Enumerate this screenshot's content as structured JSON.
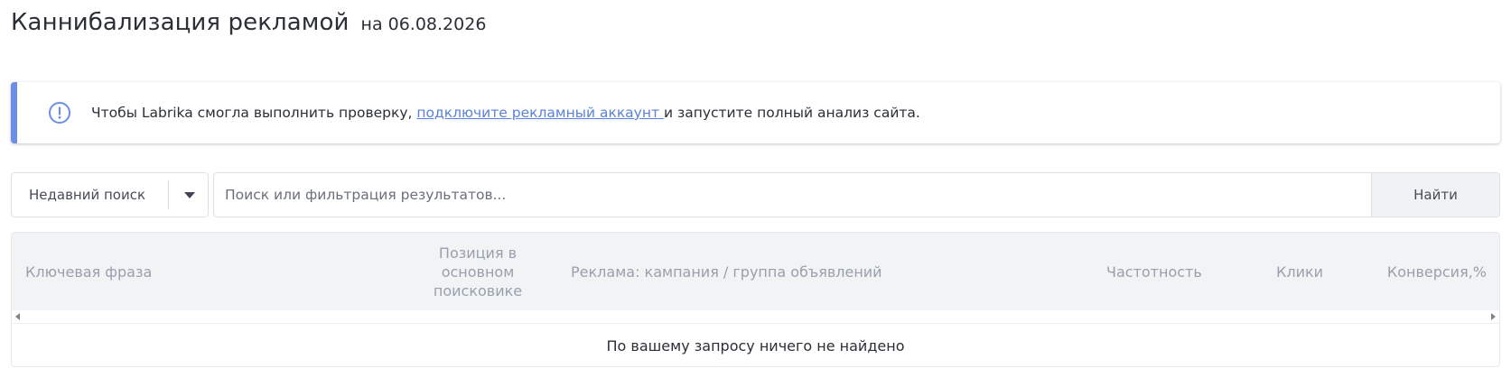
{
  "header": {
    "title": "Каннибализация рекламой",
    "date": "на 06.08.2026"
  },
  "alert": {
    "icon": "info-circle-icon",
    "accent_color": "#6b8fe6",
    "text_before": "Чтобы Labrika смогла выполнить проверку, ",
    "link_text": "подключите рекламный аккаунт ",
    "text_after": "и запустите полный анализ сайта."
  },
  "search": {
    "recent_label": "Недавний поиск",
    "dropdown_icon": "caret-down-icon",
    "placeholder": "Поиск или фильтрация результатов...",
    "value": "",
    "button_label": "Найти"
  },
  "table": {
    "columns": [
      "Ключевая фраза",
      "Позиция в основном поисковике",
      "Реклама: кампания / группа объявлений",
      "Частотность",
      "Клики",
      "Конверсия,%"
    ],
    "rows": [],
    "empty_message": "По вашему запросу ничего не найдено"
  }
}
